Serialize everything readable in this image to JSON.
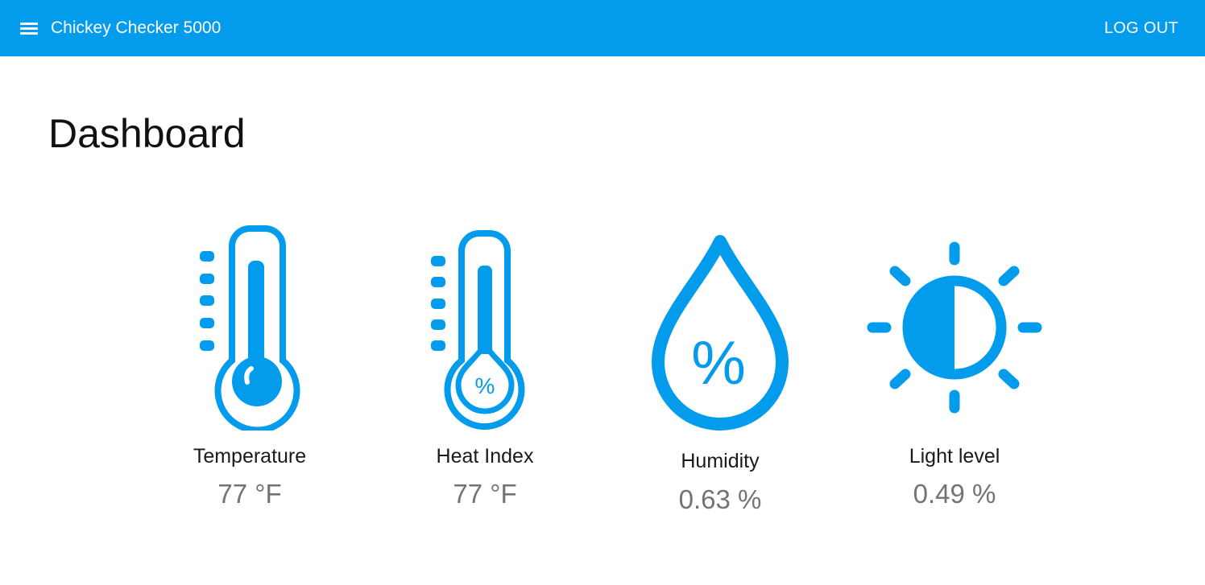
{
  "appbar": {
    "title": "Chickey Checker 5000",
    "menu_icon": "hamburger-menu-icon",
    "logout_label": "LOG OUT",
    "color": "#039BEB"
  },
  "page": {
    "title": "Dashboard"
  },
  "metrics": [
    {
      "label": "Temperature",
      "value": "77 °F",
      "icon": "thermometer-icon"
    },
    {
      "label": "Heat Index",
      "value": "77 °F",
      "icon": "heat-index-thermometer-icon"
    },
    {
      "label": "Humidity",
      "value": "0.63 %",
      "icon": "humidity-drop-icon",
      "icon_text": "%"
    },
    {
      "label": "Light level",
      "value": "0.49 %",
      "icon": "light-level-sun-icon"
    }
  ],
  "colors": {
    "accent": "#039BEB",
    "label": "#1a1a1a",
    "value": "#737373"
  }
}
